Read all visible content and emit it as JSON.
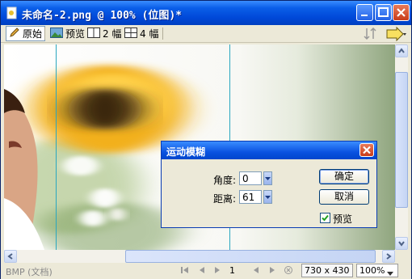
{
  "window": {
    "title": "未命名-2.png @ 100% (位图)*"
  },
  "toolbar": {
    "original": "原始",
    "preview": "预览",
    "two_up": "2 幅",
    "four_up": "4 幅"
  },
  "dialog": {
    "title": "运动模糊",
    "angle_label": "角度:",
    "angle_value": "0",
    "distance_label": "距离:",
    "distance_value": "61",
    "ok_label": "确定",
    "cancel_label": "取消",
    "preview_label": "预览",
    "preview_checked": true
  },
  "status": {
    "doc_type": "BMP (文档)",
    "page": "1",
    "size": "730 x 430",
    "zoom": "100%"
  }
}
